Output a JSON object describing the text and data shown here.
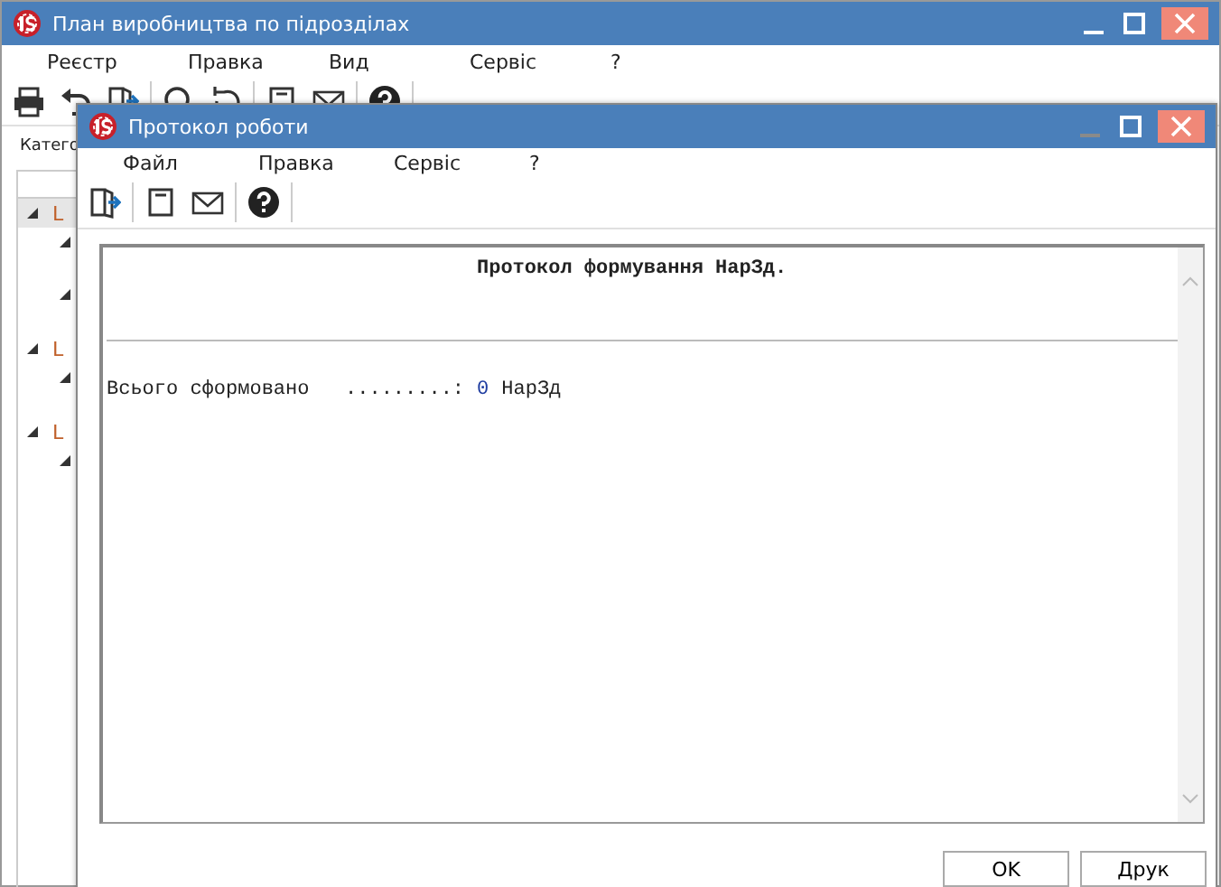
{
  "main_window": {
    "title": "План виробництва по підрозділах",
    "menu": [
      "Реєстр",
      "Правка",
      "Вид",
      "Сервіс",
      "?"
    ],
    "category_label": "Катего",
    "tree": [
      {
        "label": "L",
        "selected": true,
        "expanded": true,
        "children": [
          {
            "expanded": true
          },
          {
            "expanded": true
          }
        ]
      },
      {
        "label": "L",
        "selected": false,
        "expanded": true,
        "children": [
          {
            "expanded": true
          }
        ]
      },
      {
        "label": "L",
        "selected": false,
        "expanded": true,
        "children": [
          {
            "expanded": true
          }
        ]
      }
    ]
  },
  "dialog": {
    "title": "Протокол роботи",
    "menu": [
      "Файл",
      "Правка",
      "Сервіс",
      "?"
    ],
    "report": {
      "title": "Протокол формування НарЗд.",
      "label": "Всього сформовано   .........:",
      "count": "0",
      "unit": "НарЗд"
    },
    "buttons": [
      "OK",
      "Друк"
    ]
  }
}
